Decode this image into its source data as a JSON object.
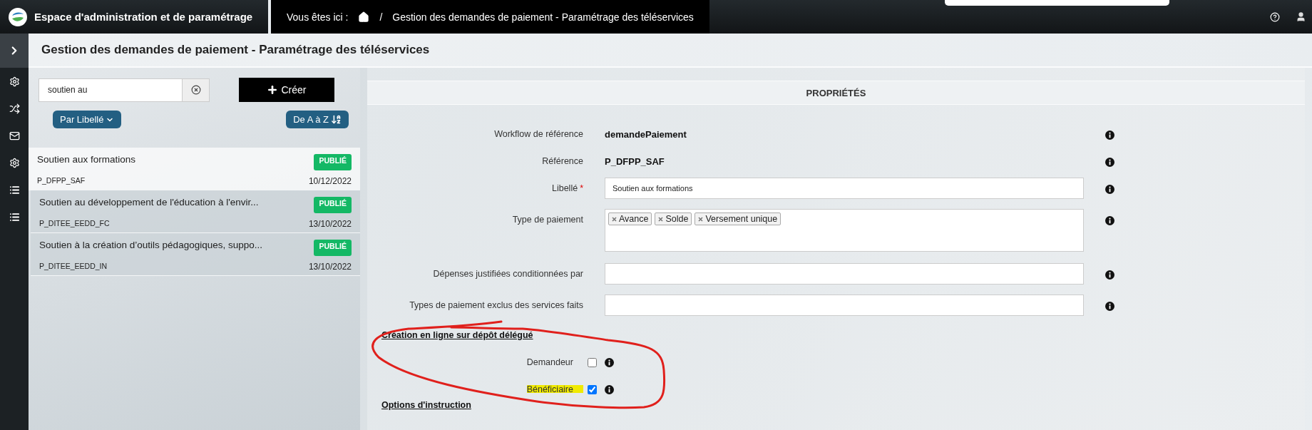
{
  "header": {
    "title": "Espace d'administration et de paramétrage",
    "breadcrumb_label": "Vous êtes ici :",
    "separator": "/",
    "breadcrumb_page": "Gestion des demandes de paiement - Paramétrage des téléservices"
  },
  "page_title": "Gestion des demandes de paiement - Paramétrage des téléservices",
  "search": {
    "value": "soutien au"
  },
  "create_button": "Créer",
  "sort_field_button": "Par Libellé",
  "sort_order_button": "De A à Z",
  "items": [
    {
      "title": "Soutien aux formations",
      "code": "P_DFPP_SAF",
      "status": "PUBLIÉ",
      "date": "10/12/2022",
      "selected": true
    },
    {
      "title": "Soutien au développement de l'éducation à l'envir...",
      "code": "P_DITEE_EEDD_FC",
      "status": "PUBLIÉ",
      "date": "13/10/2022",
      "selected": false
    },
    {
      "title": "Soutien à la création d’outils pédagogiques, suppo...",
      "code": "P_DITEE_EEDD_IN",
      "status": "PUBLIÉ",
      "date": "13/10/2022",
      "selected": false
    }
  ],
  "properties": {
    "heading": "PROPRIÉTÉS",
    "fields": [
      {
        "kind": "readonly",
        "label": "Workflow de référence",
        "value": "demandePaiement"
      },
      {
        "kind": "readonly",
        "label": "Référence",
        "value": "P_DFPP_SAF"
      },
      {
        "kind": "text",
        "label": "Libellé",
        "required_mark": "*",
        "value": "Soutien aux formations"
      },
      {
        "kind": "tags",
        "label": "Type de paiement",
        "tags": [
          "Avance",
          "Solde",
          "Versement unique"
        ]
      },
      {
        "kind": "text",
        "label": "Dépenses justifiées conditionnées par"
      },
      {
        "kind": "text",
        "label": "Types de paiement exclus des services faits"
      }
    ],
    "sections": [
      {
        "title": "Création en ligne sur dépôt délégué",
        "checkboxes": [
          {
            "label": "Demandeur",
            "checked": false,
            "highlighted": false
          },
          {
            "label": "Bénéficiaire",
            "checked": true,
            "highlighted": true
          }
        ]
      },
      {
        "title": "Options d'instruction"
      }
    ]
  }
}
